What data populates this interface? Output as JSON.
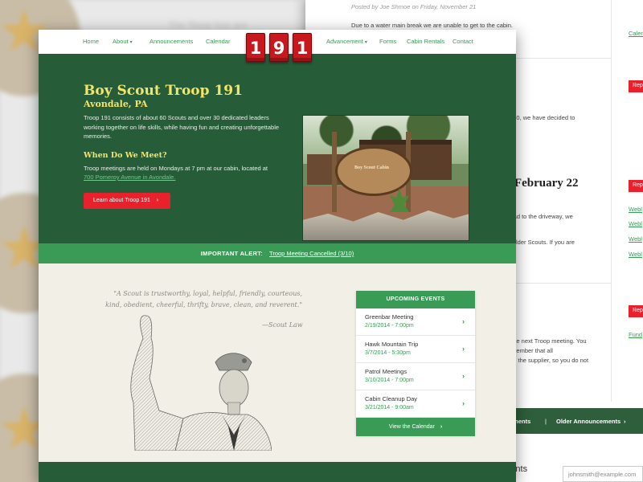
{
  "nav": {
    "items": [
      {
        "label": "Home",
        "has_dropdown": false
      },
      {
        "label": "About",
        "has_dropdown": true
      },
      {
        "label": "Announcements",
        "has_dropdown": false
      },
      {
        "label": "Calendar",
        "has_dropdown": false
      },
      {
        "label": "Advancement",
        "has_dropdown": true
      },
      {
        "label": "Forms",
        "has_dropdown": false
      },
      {
        "label": "Cabin Rentals",
        "has_dropdown": false
      },
      {
        "label": "Contact",
        "has_dropdown": false
      }
    ],
    "dropdown_icon": "chevron-down-icon"
  },
  "logo": {
    "digits": [
      "1",
      "9",
      "1"
    ],
    "color": "#c8181e"
  },
  "hero": {
    "title": "Boy Scout Troop 191",
    "subtitle": "Avondale, PA",
    "description": "Troop 191 consists of about 60 Scouts and over 30 dedicated leaders working together on life skills, while having fun and creating unforgettable memories.",
    "meet_heading": "When Do We Meet?",
    "meet_text": "Troop meetings are held on Mondays at 7 pm at our cabin, located at",
    "address": "700 Pomeroy Avenue in Avondale.",
    "button_label": "Learn about Troop 191",
    "button_icon": "chevron-right-icon",
    "photo_sign_text": "Boy Scout Cabin",
    "background": "#275c39",
    "title_color": "#f3e56a"
  },
  "alert": {
    "label": "IMPORTANT ALERT:",
    "link_text": "Troop Meeting Cancelled (3/10)",
    "background": "#3a9b57"
  },
  "quote": {
    "text": "\"A Scout is trustworthy, loyal, helpful, friendly, courteous, kind, obedient, cheerful, thrifty, brave, clean, and reverent.\"",
    "author": "—Scout Law"
  },
  "events": {
    "heading": "UPCOMING EVENTS",
    "items": [
      {
        "title": "Greenbar Meeting",
        "date": "2/19/2014 - 7:00pm"
      },
      {
        "title": "Hawk Mountain Trip",
        "date": "3/7/2014 - 5:30pm"
      },
      {
        "title": "Patrol Meetings",
        "date": "3/10/2014 - 7:00pm"
      },
      {
        "title": "Cabin Cleanup Day",
        "date": "3/21/2014 - 9:00am"
      }
    ],
    "button_label": "View the Calendar",
    "item_icon": "chevron-right-icon"
  },
  "background_page": {
    "posted_by": "Posted by Joe Shmoe on Friday, November 21",
    "lines": [
      "Due to a water main break we are unable to get to the cabin.",
      "6:30, we have decided to",
      "road to the driveway, we",
      "y older Scouts. If you are",
      "t the next Troop meeting. You",
      "emember that all",
      "om the supplier, so you do not"
    ],
    "heading": "l February 22",
    "red_label": "Rep",
    "side_links": [
      "Calen",
      "Webl",
      "Webl",
      "Webl",
      "Webl",
      "Fund"
    ],
    "footer_links": [
      "ements",
      "|",
      "Older Announcements"
    ],
    "footer_icon": "chevron-right-icon",
    "section_heading": "ements",
    "email_placeholder": "johnsmith@example.com"
  },
  "left_backdrop": {
    "blurred_text": "The Troop bus are"
  }
}
